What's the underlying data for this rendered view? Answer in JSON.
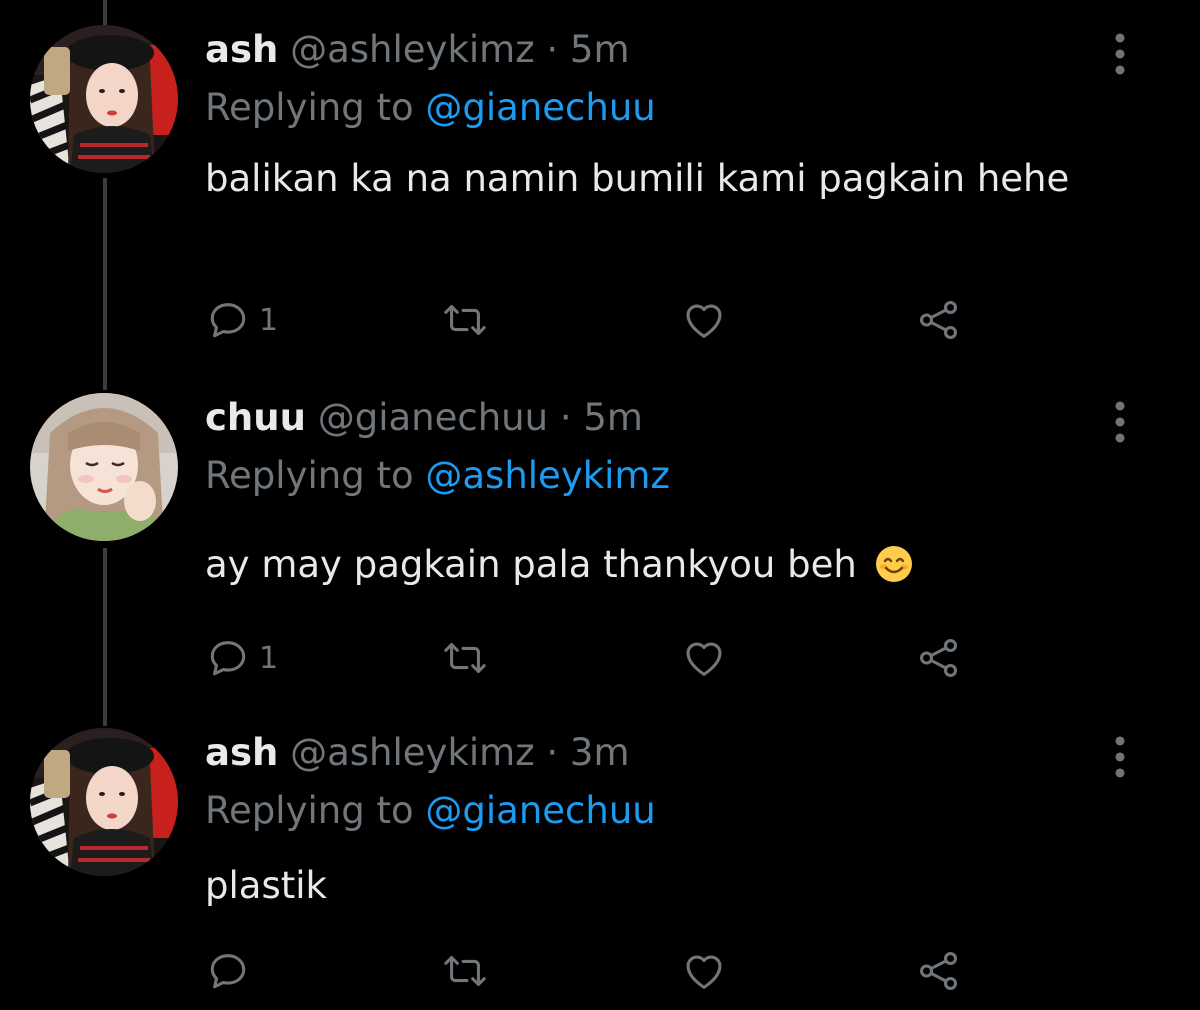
{
  "colors": {
    "background": "#000000",
    "primary_text": "#e7e9ea",
    "secondary_text": "#71767b",
    "link": "#1d9bf0",
    "thread_line": "#3a3d40"
  },
  "tweets": [
    {
      "name": "ash",
      "handle": "@ashleykimz",
      "separator": "·",
      "time": "5m",
      "replying_label": "Replying to",
      "replying_handle": "@gianechuu",
      "text": "balikan ka na namin bumili kami pagkain hehe",
      "reply_count": "1",
      "icons": [
        "more-icon",
        "reply-icon",
        "retweet-icon",
        "like-icon",
        "share-icon"
      ]
    },
    {
      "name": "chuu",
      "handle": "@gianechuu",
      "separator": "·",
      "time": "5m",
      "replying_label": "Replying to",
      "replying_handle": "@ashleykimz",
      "text": "ay may pagkain pala thankyou beh",
      "emoji": "smiling-face-emoji",
      "reply_count": "1",
      "icons": [
        "more-icon",
        "reply-icon",
        "retweet-icon",
        "like-icon",
        "share-icon"
      ]
    },
    {
      "name": "ash",
      "handle": "@ashleykimz",
      "separator": "·",
      "time": "3m",
      "replying_label": "Replying to",
      "replying_handle": "@gianechuu",
      "text": "plastik",
      "reply_count": "",
      "icons": [
        "more-icon",
        "reply-icon",
        "retweet-icon",
        "like-icon",
        "share-icon"
      ]
    }
  ]
}
